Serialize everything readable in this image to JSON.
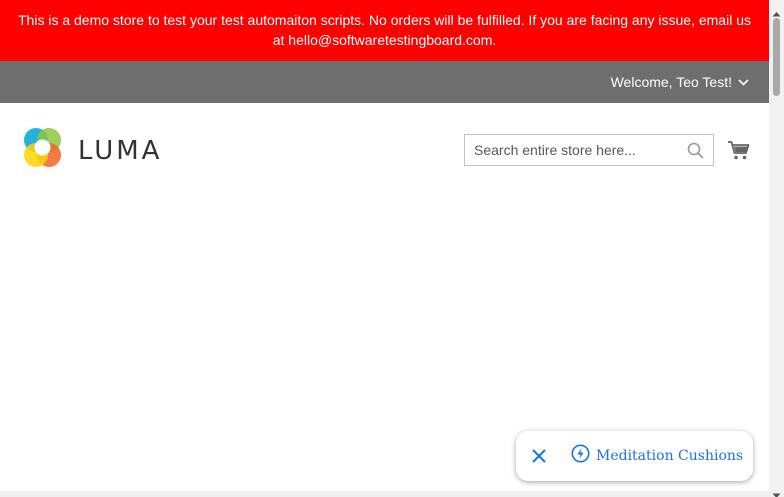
{
  "banner": {
    "text": "This is a demo store to test your test automaiton scripts. No orders will be fulfilled. If you are facing any issue, email us at hello@softwaretestingboard.com."
  },
  "header": {
    "welcome_text": "Welcome, Teo Test!",
    "logo_text": "LUMA"
  },
  "search": {
    "placeholder": "Search entire store here..."
  },
  "suggestion_chip": {
    "label": "Meditation Cushions"
  },
  "colors": {
    "banner_bg": "#ff0000",
    "panel_bg": "#6e6e6e",
    "chip_accent": "#1a73e8"
  },
  "icons": {
    "search": "search-icon",
    "cart": "cart-icon",
    "chevron": "chevron-down-icon",
    "close": "close-icon",
    "bolt": "lightning-icon"
  }
}
